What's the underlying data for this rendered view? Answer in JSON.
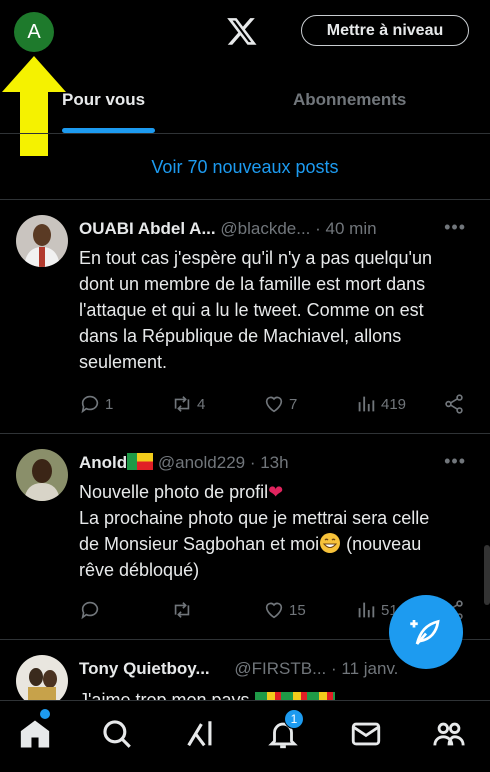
{
  "header": {
    "avatar_letter": "A",
    "upgrade_label": "Mettre à niveau"
  },
  "tabs": [
    {
      "label": "Pour vous",
      "active": true
    },
    {
      "label": "Abonnements",
      "active": false
    }
  ],
  "new_posts_label": "Voir 70 nouveaux posts",
  "posts": [
    {
      "name": "OUABI Abdel A...",
      "handle": "@blackde...",
      "time": "· 40 min",
      "more": "•••",
      "lines": [
        "En tout cas j'espère qu'il n'y a pas quelqu'un",
        "dont un membre de la famille est mort dans",
        "l'attaque et qui a lu le tweet.  Comme on est",
        "dans la République de Machiavel, allons",
        "seulement."
      ],
      "replies": "1",
      "reposts": "4",
      "likes": "7",
      "views": "419"
    },
    {
      "name": "Anold",
      "handle": "@anold229",
      "time": "· 13h",
      "more": "•••",
      "line1": "Nouvelle photo de profil",
      "line2": "La prochaine photo que je mettrai sera celle",
      "line3a": "de Monsieur Sagbohan et moi",
      "line3b": " (nouveau",
      "line4": "rêve débloqué)",
      "replies": "",
      "reposts": "",
      "likes": "15",
      "views": "51"
    },
    {
      "name": "Tony Quietboy...",
      "handle": "@FIRSTB...",
      "time": "· 11 janv.",
      "text": "J'aime trop mon pays"
    }
  ],
  "nav": {
    "notifications_count": "1",
    "items": [
      "home",
      "search",
      "grok",
      "notifications",
      "messages",
      "communities"
    ]
  },
  "colors": {
    "accent": "#1d9bf0",
    "background": "#000000",
    "muted": "#71767b",
    "arrow": "#f5f200"
  }
}
